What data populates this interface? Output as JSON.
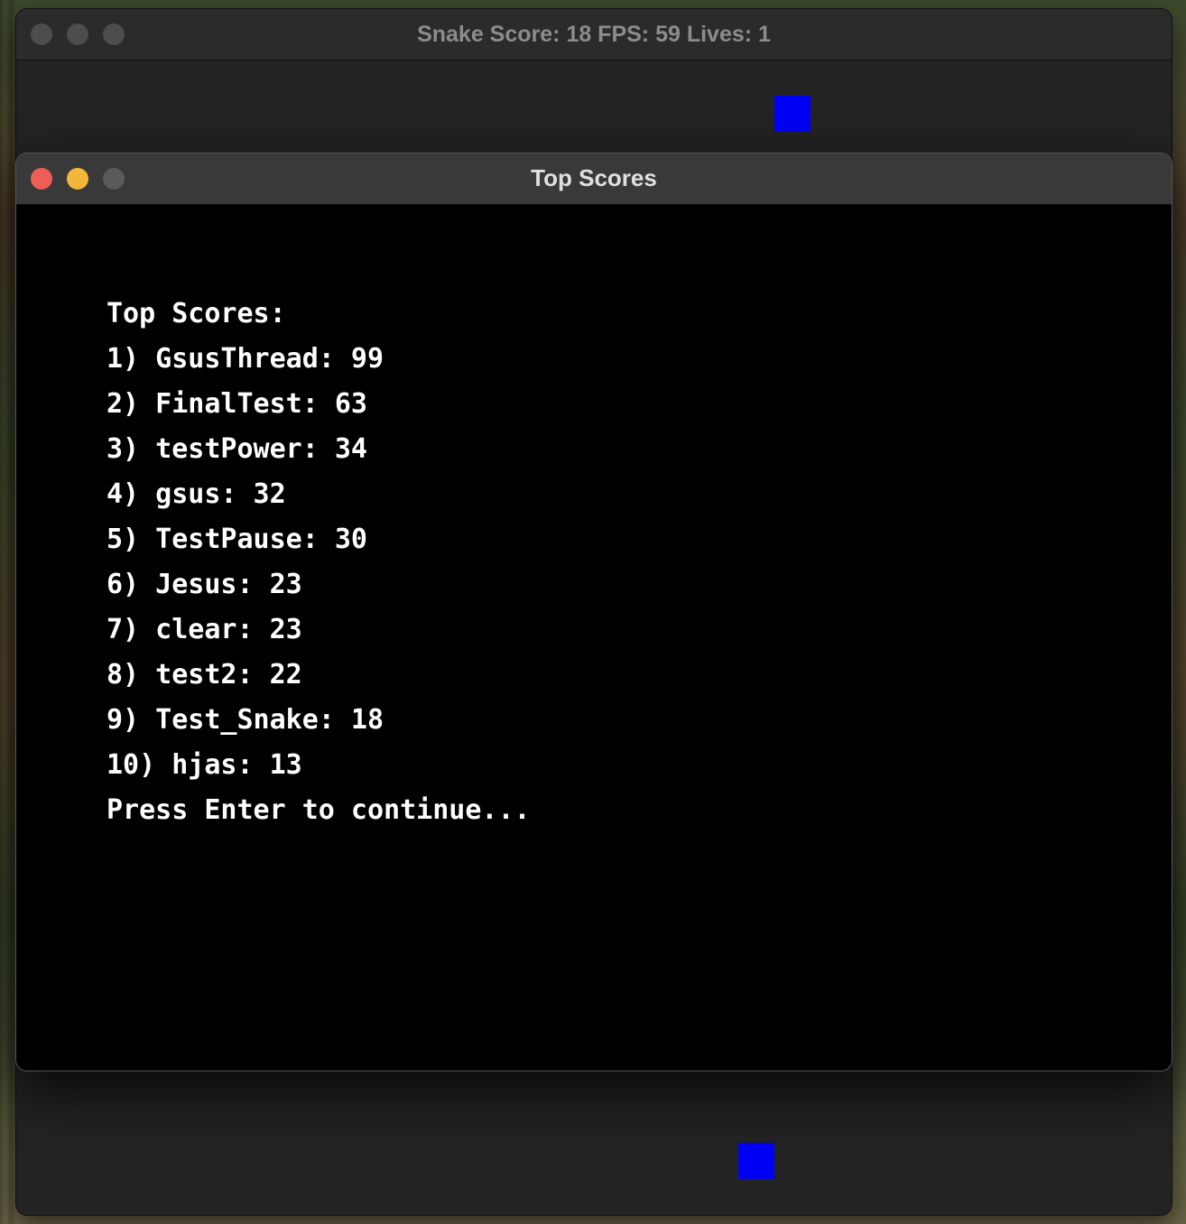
{
  "game_window": {
    "title": "Snake Score: 18 FPS: 59 Lives: 1",
    "food_color": "#0000f5"
  },
  "scores_window": {
    "title": "Top Scores",
    "heading": "Top Scores:",
    "entries": [
      "1) GsusThread: 99",
      "2) FinalTest: 63",
      "3) testPower: 34",
      "4) gsus: 32",
      "5) TestPause: 30",
      "6) Jesus: 23",
      "7) clear: 23",
      "8) test2: 22",
      "9) Test_Snake: 18",
      "10) hjas: 13"
    ],
    "prompt": "Press Enter to continue..."
  }
}
